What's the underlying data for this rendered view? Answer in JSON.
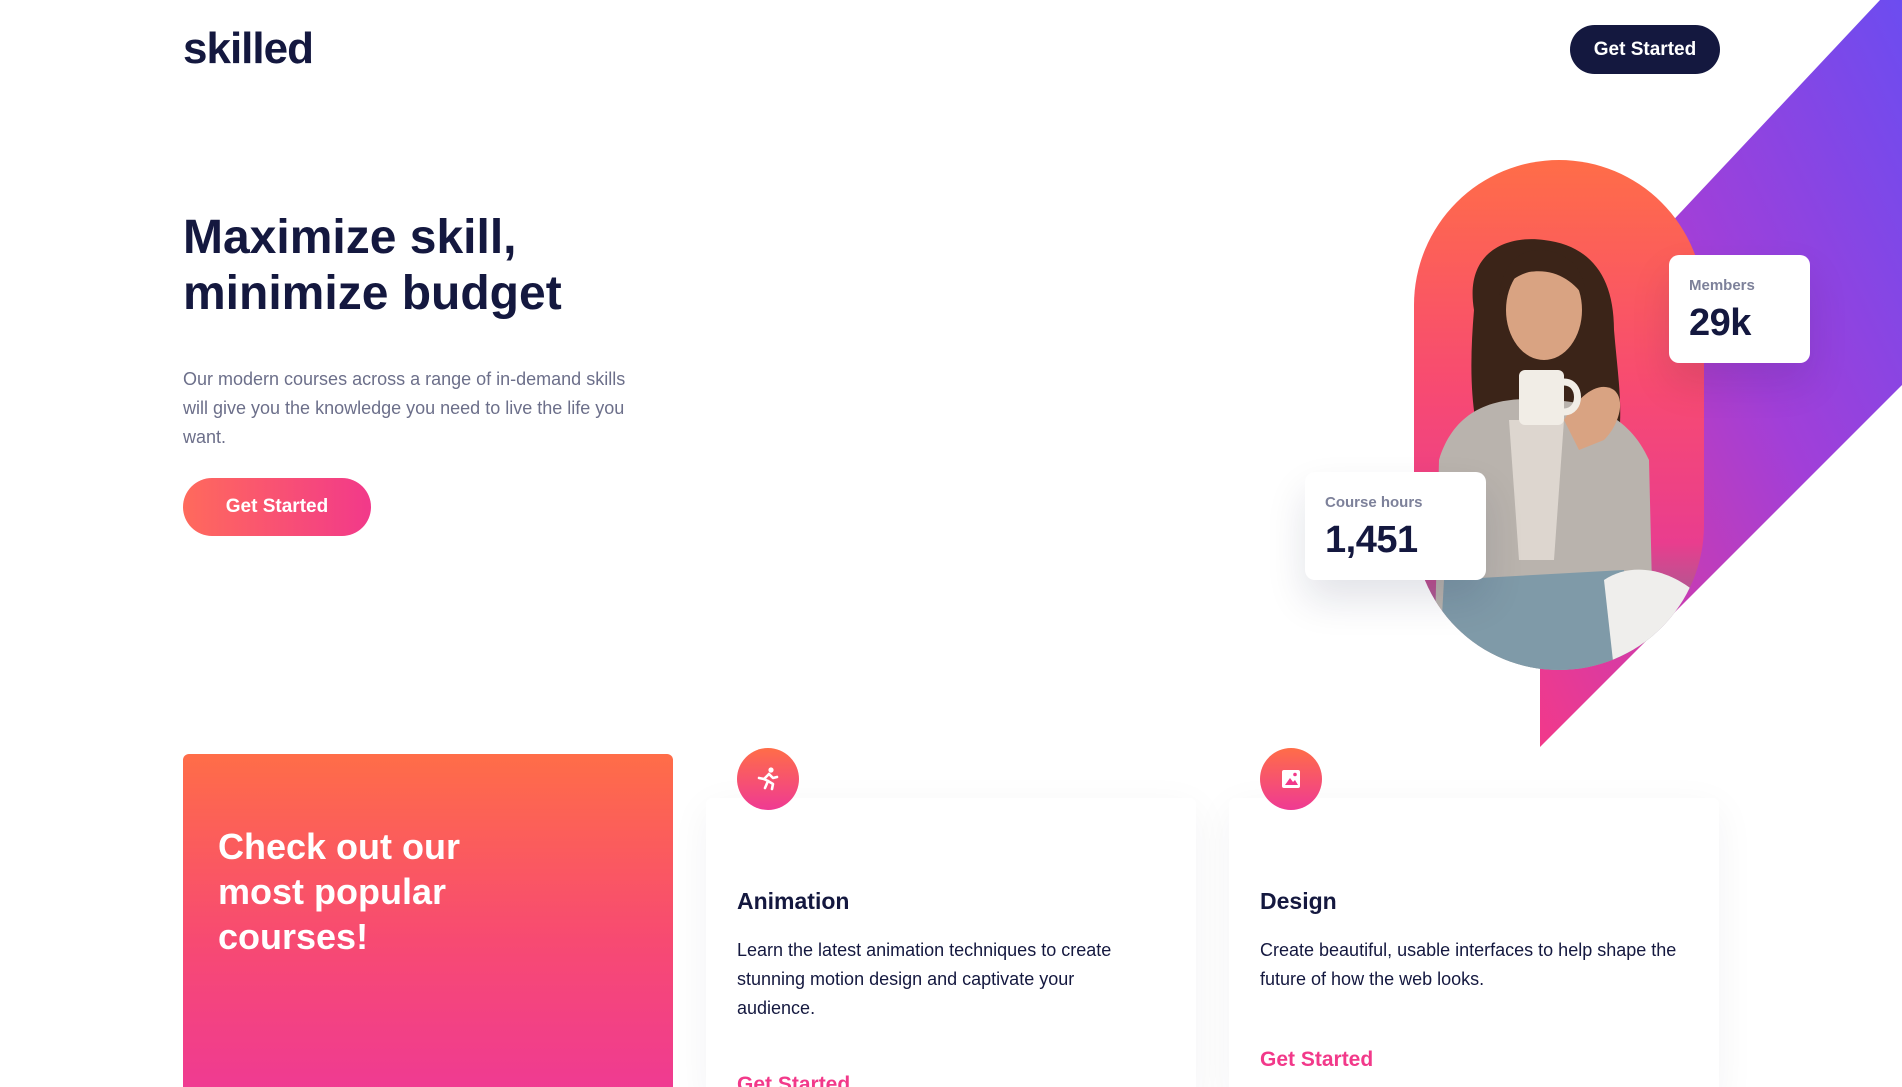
{
  "brand": {
    "logo": "skilled",
    "accent": "#f2398a",
    "accent_orange": "#ff6d48",
    "dark": "#14183f",
    "band_gradient": [
      "#f2398a",
      "#6c4cf0"
    ]
  },
  "header": {
    "cta_label": "Get Started"
  },
  "hero": {
    "title_line1": "Maximize skill,",
    "title_line2": "minimize budget",
    "description": "Our modern courses across a range of in-demand skills will give you the knowledge you need to live the life you want.",
    "cta_label": "Get Started"
  },
  "stats": {
    "members_label": "Members",
    "members_value": "29k",
    "hours_label": "Course hours",
    "hours_value": "1,451"
  },
  "courses_section": {
    "promo_line1": "Check out our",
    "promo_line2": "most popular",
    "promo_line3": "courses!",
    "cards": [
      {
        "icon": "running-figure-icon",
        "title": "Animation",
        "description": "Learn the latest animation techniques to create stunning motion design and captivate your audience.",
        "link": "Get Started"
      },
      {
        "icon": "image-frame-icon",
        "title": "Design",
        "description": "Create beautiful, usable interfaces to help shape the future of how the web looks.",
        "link": "Get Started"
      }
    ]
  }
}
